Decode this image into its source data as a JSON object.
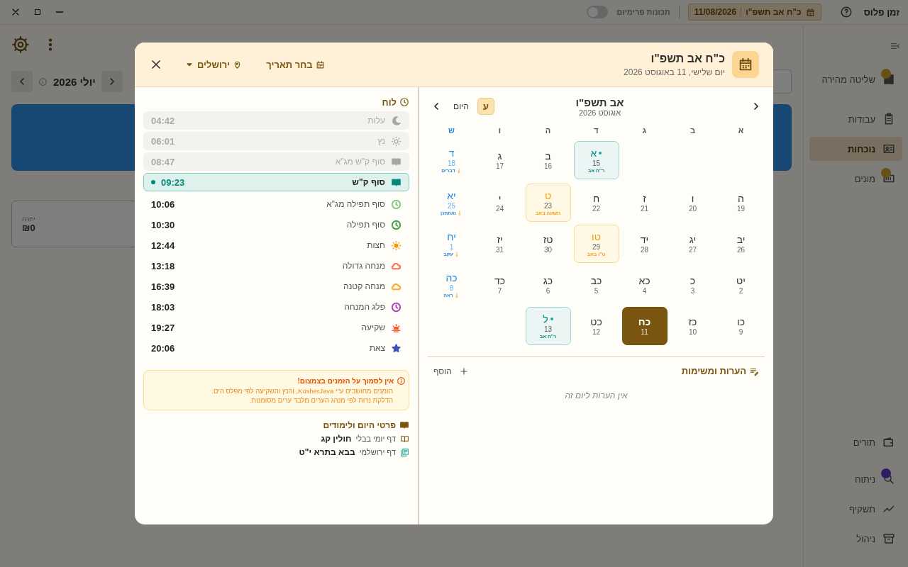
{
  "app": {
    "title": "זמן פלוס",
    "date_chip": {
      "hebrew": "כ\"ח אב תשפ\"ו",
      "gregorian": "11/08/2026"
    },
    "premium": {
      "label": "תכונות פרימיום",
      "on": false
    },
    "sidebar_top": [
      {
        "label": "שליטה מהירה",
        "selected": false,
        "badge": true
      },
      {
        "label": "עבודות",
        "selected": false,
        "badge": false
      },
      {
        "label": "נוכחות",
        "selected": true,
        "badge": false
      },
      {
        "label": "מונים",
        "selected": false,
        "badge": true
      }
    ],
    "sidebar_bottom": [
      {
        "label": "תורים",
        "selected": false,
        "badge": false
      },
      {
        "label": "ניתוח",
        "selected": false,
        "badge": true
      },
      {
        "label": "תשקיף",
        "selected": false,
        "badge": false
      },
      {
        "label": "ניהול",
        "selected": false,
        "badge": false
      }
    ],
    "month": "יולי 2026",
    "balance_label": "יתרה",
    "balance_value": "₪0"
  },
  "dialog": {
    "title": "כ\"ח אב תשפ\"ו",
    "subtitle": "יום שלישי, 11 באוגוסט 2026",
    "pick_date": "בחר תאריך",
    "location": "ירושלים",
    "calendar": {
      "month_hebrew": "אב תשפ\"ו",
      "month_gregorian": "אוגוסט 2026",
      "hebrew_toggle": {
        "label": "ע",
        "selected": true
      },
      "today": "היום",
      "weekdays": [
        {
          "label": "א",
          "kind": "weekday"
        },
        {
          "label": "ב",
          "kind": "weekday"
        },
        {
          "label": "ג",
          "kind": "weekday"
        },
        {
          "label": "ד",
          "kind": "weekday"
        },
        {
          "label": "ה",
          "kind": "weekday"
        },
        {
          "label": "ו",
          "kind": "weekday"
        },
        {
          "label": "ש",
          "kind": "shabbat"
        }
      ],
      "weeks": [
        [
          {
            "hebrew": "א",
            "gregorian": "15",
            "note": "ר\"ח אב",
            "kind": "rosh_chodesh",
            "selected": false
          },
          {
            "hebrew": "ב",
            "gregorian": "16",
            "kind": "weekday",
            "selected": false
          },
          {
            "hebrew": "ג",
            "gregorian": "17",
            "kind": "weekday",
            "selected": false
          },
          {
            "hebrew": "ד",
            "gregorian": "18",
            "note": "דברים",
            "kind": "shabbat",
            "selected": false
          }
        ],
        [
          {
            "hebrew": "ה",
            "gregorian": "19",
            "kind": "weekday",
            "selected": false
          },
          {
            "hebrew": "ו",
            "gregorian": "20",
            "kind": "weekday",
            "selected": false
          },
          {
            "hebrew": "ז",
            "gregorian": "21",
            "kind": "weekday",
            "selected": false
          },
          {
            "hebrew": "ח",
            "gregorian": "22",
            "kind": "weekday",
            "selected": false
          },
          {
            "hebrew": "ט",
            "gregorian": "23",
            "note": "תשעה באב",
            "kind": "special",
            "selected": false
          },
          {
            "hebrew": "י",
            "gregorian": "24",
            "kind": "weekday",
            "selected": false
          },
          {
            "hebrew": "יא",
            "gregorian": "25",
            "note": "ואתחנן",
            "kind": "shabbat",
            "selected": false
          }
        ],
        [
          {
            "hebrew": "יב",
            "gregorian": "26",
            "kind": "weekday",
            "selected": false
          },
          {
            "hebrew": "יג",
            "gregorian": "27",
            "kind": "weekday",
            "selected": false
          },
          {
            "hebrew": "יד",
            "gregorian": "28",
            "kind": "weekday",
            "selected": false
          },
          {
            "hebrew": "טו",
            "gregorian": "29",
            "note": "ט\"ו באב",
            "kind": "special",
            "selected": false
          },
          {
            "hebrew": "טז",
            "gregorian": "30",
            "kind": "weekday",
            "selected": false
          },
          {
            "hebrew": "יז",
            "gregorian": "31",
            "kind": "weekday",
            "selected": false
          },
          {
            "hebrew": "יח",
            "gregorian": "1",
            "note": "עקב",
            "kind": "shabbat",
            "selected": false
          }
        ],
        [
          {
            "hebrew": "יט",
            "gregorian": "2",
            "kind": "weekday",
            "selected": false
          },
          {
            "hebrew": "כ",
            "gregorian": "3",
            "kind": "weekday",
            "selected": false
          },
          {
            "hebrew": "כא",
            "gregorian": "4",
            "kind": "weekday",
            "selected": false
          },
          {
            "hebrew": "כב",
            "gregorian": "5",
            "kind": "weekday",
            "selected": false
          },
          {
            "hebrew": "כג",
            "gregorian": "6",
            "kind": "weekday",
            "selected": false
          },
          {
            "hebrew": "כד",
            "gregorian": "7",
            "kind": "weekday",
            "selected": false
          },
          {
            "hebrew": "כה",
            "gregorian": "8",
            "note": "ראה",
            "kind": "shabbat",
            "selected": false
          }
        ],
        [
          {
            "hebrew": "כו",
            "gregorian": "9",
            "kind": "weekday",
            "selected": false
          },
          {
            "hebrew": "כז",
            "gregorian": "10",
            "kind": "weekday",
            "selected": false
          },
          {
            "hebrew": "כח",
            "gregorian": "11",
            "kind": "weekday",
            "selected": true
          },
          {
            "hebrew": "כט",
            "gregorian": "12",
            "kind": "weekday",
            "selected": false
          },
          {
            "hebrew": "ל",
            "gregorian": "13",
            "note": "ר\"ח אב",
            "kind": "rosh_chodesh",
            "selected": false
          }
        ]
      ]
    },
    "notes": {
      "title": "הערות ומשימות",
      "add": "הוסף",
      "empty": "אין הערות ליום זה"
    },
    "zmanim": {
      "title": "לוח",
      "items": [
        {
          "name": "עלות",
          "time": "04:42",
          "color": "#a8a6a2",
          "past": true,
          "current": false
        },
        {
          "name": "נץ",
          "time": "06:01",
          "color": "#a8a6a2",
          "past": true,
          "current": false
        },
        {
          "name": "סוף ק\"ש מג\"א",
          "time": "08:47",
          "color": "#a8a6a2",
          "past": true,
          "current": false
        },
        {
          "name": "סוף ק\"ש",
          "time": "09:23",
          "color": "#00897b",
          "past": false,
          "current": true
        },
        {
          "name": "סוף תפילה מג\"א",
          "time": "10:06",
          "color": "#81c784",
          "past": false,
          "current": false
        },
        {
          "name": "סוף תפילה",
          "time": "10:30",
          "color": "#43a047",
          "past": false,
          "current": false
        },
        {
          "name": "חצות",
          "time": "12:44",
          "color": "#ff9800",
          "past": false,
          "current": false
        },
        {
          "name": "מנחה גדולה",
          "time": "13:18",
          "color": "#ff7043",
          "past": false,
          "current": false
        },
        {
          "name": "מנחה קטנה",
          "time": "16:39",
          "color": "#ffa726",
          "past": false,
          "current": false
        },
        {
          "name": "פלג המנחה",
          "time": "18:03",
          "color": "#ab47bc",
          "past": false,
          "current": false
        },
        {
          "name": "שקיעה",
          "time": "19:27",
          "color": "#ff5722",
          "past": false,
          "current": false
        },
        {
          "name": "צאת",
          "time": "20:06",
          "color": "#3f51b5",
          "past": false,
          "current": false
        }
      ]
    },
    "warning": {
      "title": "אין לסמוך על הזמנים בצמצום!",
      "lines": [
        "הזמנים מחושבים ע\"י KosherJava, והנץ והשקיעה לפי מפלס הים.",
        "הדלקת נרות לפי מנהג הערים מלבד ערים מסומנות."
      ]
    },
    "details": {
      "title": "פרטי היום ולימודים",
      "rows": [
        {
          "label": "דף יומי בבלי",
          "value": "חולין קג"
        },
        {
          "label": "דף ירושלמי",
          "value": "בבא בתרא י\"ט"
        }
      ]
    }
  }
}
